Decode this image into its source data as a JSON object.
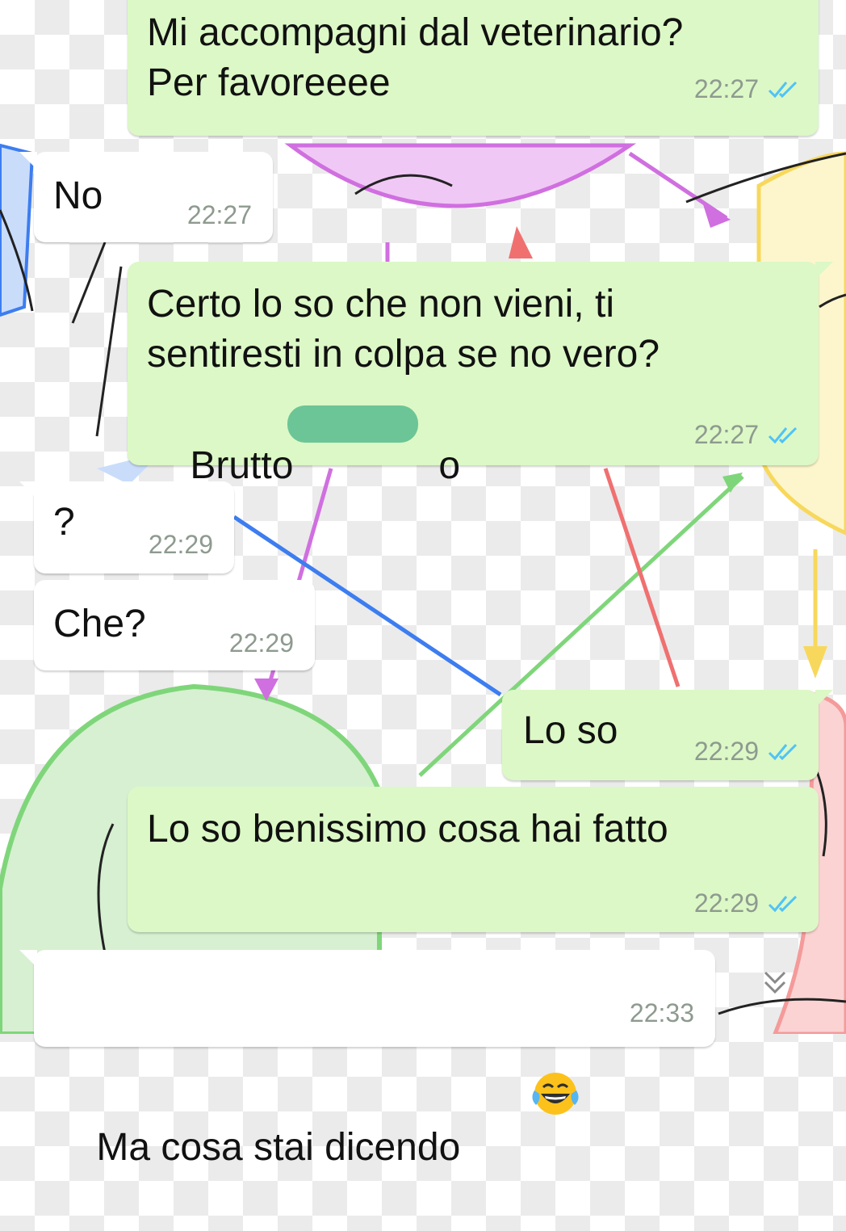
{
  "chat": {
    "messages": [
      {
        "direction": "outgoing",
        "text": "Mi accompagni dal veterinario?\nPer favoreeee",
        "time": "22:27",
        "status_icon": "double-check-read-icon"
      },
      {
        "direction": "incoming",
        "text": "No",
        "time": "22:27"
      },
      {
        "direction": "outgoing",
        "text": "Certo lo so che non vieni, ti\nsentiresti in colpa se no vero?",
        "text_before_redaction": "Brutto",
        "text_after_redaction": "o",
        "time": "22:27",
        "status_icon": "double-check-read-icon"
      },
      {
        "direction": "incoming",
        "text": "?",
        "time": "22:29"
      },
      {
        "direction": "incoming",
        "text": "Che?",
        "time": "22:29"
      },
      {
        "direction": "outgoing",
        "text": "Lo so",
        "time": "22:29",
        "status_icon": "double-check-read-icon"
      },
      {
        "direction": "outgoing",
        "text": "Lo so benissimo cosa hai fatto",
        "time": "22:29",
        "status_icon": "double-check-read-icon"
      },
      {
        "direction": "incoming",
        "text": "Ma cosa stai dicendo",
        "emoji": "face-with-tears-of-joy-icon",
        "time": "22:33"
      }
    ],
    "scroll_button_icon": "chevron-double-down-icon"
  },
  "colors": {
    "outgoing_bubble": "#dcf8c6",
    "incoming_bubble": "#ffffff",
    "read_ticks": "#4fc3f7",
    "timestamp": "#8e9a8f",
    "redaction": "#6cc596"
  }
}
